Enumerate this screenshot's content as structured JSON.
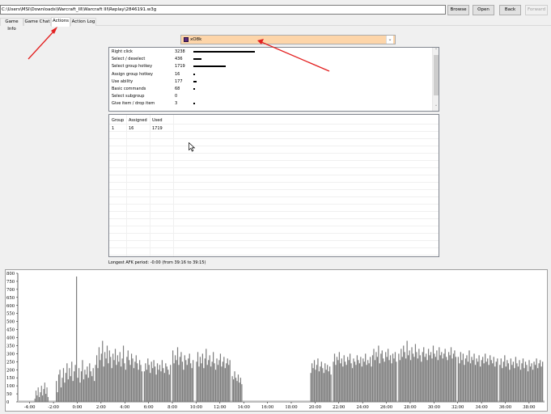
{
  "toolbar": {
    "path_value": "C:\\Users\\MSI\\Downloads\\Warcraft_III\\Warcraft III\\Replay\\2846191.w3g",
    "browse_label": "Browse",
    "open_label": "Open",
    "back_label": "Back",
    "forward_label": "Forward"
  },
  "tabs": [
    {
      "label": "Game Info"
    },
    {
      "label": "Game Chat"
    },
    {
      "label": "Actions"
    },
    {
      "label": "Action Log"
    }
  ],
  "active_tab": "Actions",
  "player": {
    "name": "xO8k",
    "flag_color": "#5b2b7a"
  },
  "actions": [
    {
      "label": "Right click",
      "value": "3238"
    },
    {
      "label": "Select / deselect",
      "value": "436"
    },
    {
      "label": "Select group hotkey",
      "value": "1719"
    },
    {
      "label": "Assign group hotkey",
      "value": "16"
    },
    {
      "label": "Use ability",
      "value": "177"
    },
    {
      "label": "Basic commands",
      "value": "68"
    },
    {
      "label": "Select subgroup",
      "value": "0"
    },
    {
      "label": "Give item / drop item",
      "value": "3"
    }
  ],
  "groups": {
    "headers": [
      "Group",
      "Assigned",
      "Used"
    ],
    "rows": [
      [
        "1",
        "16",
        "1719"
      ]
    ]
  },
  "afk_text": "Longest AFK period: -0:00 (from 39:16 to 39:15)",
  "chart_data": {
    "type": "bar",
    "ylim": [
      0,
      800
    ],
    "yticks": [
      "0",
      "50",
      "100",
      "150",
      "200",
      "250",
      "300",
      "350",
      "400",
      "450",
      "500",
      "550",
      "600",
      "650",
      "700",
      "750",
      "800"
    ],
    "xlim": [
      -5,
      39.3
    ],
    "xticks": [
      "-4:00",
      "-2:00",
      "0:00",
      "2:00",
      "4:00",
      "6:00",
      "8:00",
      "10:00",
      "12:00",
      "14:00",
      "16:00",
      "18:00",
      "20:00",
      "22:00",
      "24:00",
      "26:00",
      "28:00",
      "30:00",
      "32:00",
      "34:00",
      "36:00",
      "38:00"
    ],
    "xtick_minutes": [
      -4,
      -2,
      0,
      2,
      4,
      6,
      8,
      10,
      12,
      14,
      16,
      18,
      20,
      22,
      24,
      26,
      28,
      30,
      32,
      34,
      36,
      38
    ],
    "bar_color": "#7d7d7d",
    "segments": [
      {
        "start": -3.6,
        "end": -2.4,
        "values": [
          20,
          70,
          40,
          90,
          30,
          60,
          100,
          40,
          80,
          120,
          50,
          90,
          30
        ]
      },
      {
        "start": -1.8,
        "end": 1.6,
        "values": [
          130,
          60,
          170,
          200,
          90,
          150,
          210,
          120,
          180,
          240,
          140,
          210,
          160,
          250,
          130,
          190,
          230,
          780,
          150,
          210,
          120,
          190,
          260,
          140,
          200,
          170,
          220,
          150,
          240,
          190,
          160,
          210,
          130,
          230
        ]
      },
      {
        "start": 1.6,
        "end": 5.5,
        "values": [
          290,
          210,
          340,
          260,
          300,
          380,
          220,
          310,
          270,
          350,
          240,
          320,
          280,
          210,
          300,
          260,
          330,
          230,
          290,
          250,
          310,
          220,
          270,
          350,
          240,
          200,
          280,
          320,
          260,
          230,
          300,
          270,
          210,
          250,
          290,
          240,
          200,
          260,
          230,
          190
        ]
      },
      {
        "start": 5.6,
        "end": 7.9,
        "values": [
          190,
          240,
          200,
          270,
          230,
          180,
          250,
          210,
          260,
          220,
          170,
          240,
          200,
          230,
          190,
          260,
          210,
          180,
          240,
          220,
          200,
          170,
          230
        ]
      },
      {
        "start": 8.0,
        "end": 9.8,
        "values": [
          320,
          240,
          290,
          260,
          340,
          230,
          280,
          310,
          250,
          200,
          290,
          260,
          230,
          270,
          300,
          240,
          210,
          260
        ]
      },
      {
        "start": 10.0,
        "end": 12.9,
        "values": [
          250,
          310,
          220,
          280,
          240,
          300,
          210,
          270,
          330,
          230,
          260,
          290,
          220,
          250,
          310,
          240,
          200,
          270,
          230,
          260,
          300,
          220,
          250,
          280,
          210,
          240,
          270,
          230,
          260
        ]
      },
      {
        "start": 13.0,
        "end": 13.9,
        "values": [
          160,
          140,
          190,
          150,
          130,
          170,
          120,
          150,
          110
        ]
      },
      {
        "start": 19.6,
        "end": 21.4,
        "values": [
          180,
          240,
          210,
          260,
          200,
          230,
          270,
          190,
          220,
          250,
          210,
          180,
          240,
          200,
          230,
          190,
          220,
          170
        ]
      },
      {
        "start": 21.5,
        "end": 24.8,
        "values": [
          250,
          300,
          230,
          280,
          260,
          310,
          240,
          270,
          220,
          290,
          250,
          230,
          280,
          260,
          300,
          240,
          210,
          270,
          250,
          230,
          290,
          260,
          240,
          280,
          220,
          270,
          250,
          300,
          230,
          260,
          240,
          280,
          220
        ]
      },
      {
        "start": 24.8,
        "end": 26.9,
        "values": [
          290,
          330,
          260,
          310,
          280,
          350,
          240,
          300,
          320,
          270,
          250,
          310,
          280,
          330,
          260,
          290,
          240,
          300,
          270,
          310,
          250
        ]
      },
      {
        "start": 27.0,
        "end": 31.9,
        "values": [
          300,
          260,
          330,
          280,
          350,
          310,
          270,
          380,
          290,
          320,
          260,
          340,
          300,
          280,
          360,
          310,
          270,
          330,
          290,
          250,
          310,
          340,
          280,
          300,
          260,
          330,
          290,
          310,
          270,
          350,
          300,
          280,
          320,
          260,
          340,
          290,
          310,
          270,
          300,
          330,
          280,
          260,
          310,
          290,
          340,
          270,
          300,
          320,
          280
        ]
      },
      {
        "start": 32.0,
        "end": 35.4,
        "values": [
          280,
          240,
          310,
          260,
          300,
          230,
          270,
          290,
          250,
          320,
          240,
          280,
          260,
          300,
          230,
          270,
          250,
          290,
          220,
          260,
          280,
          240,
          300,
          250,
          270,
          230,
          290,
          260,
          240,
          280,
          220,
          250,
          270
        ]
      },
      {
        "start": 35.5,
        "end": 39.2,
        "values": [
          230,
          270,
          210,
          250,
          290,
          220,
          260,
          240,
          200,
          270,
          230,
          250,
          210,
          280,
          240,
          220,
          260,
          200,
          240,
          270,
          210,
          250,
          230,
          190,
          260,
          220,
          240,
          200,
          250,
          230,
          270,
          210,
          240,
          260,
          220,
          250
        ]
      }
    ],
    "idle_series": {
      "start": -5,
      "end": 39.3,
      "value": 8
    }
  }
}
